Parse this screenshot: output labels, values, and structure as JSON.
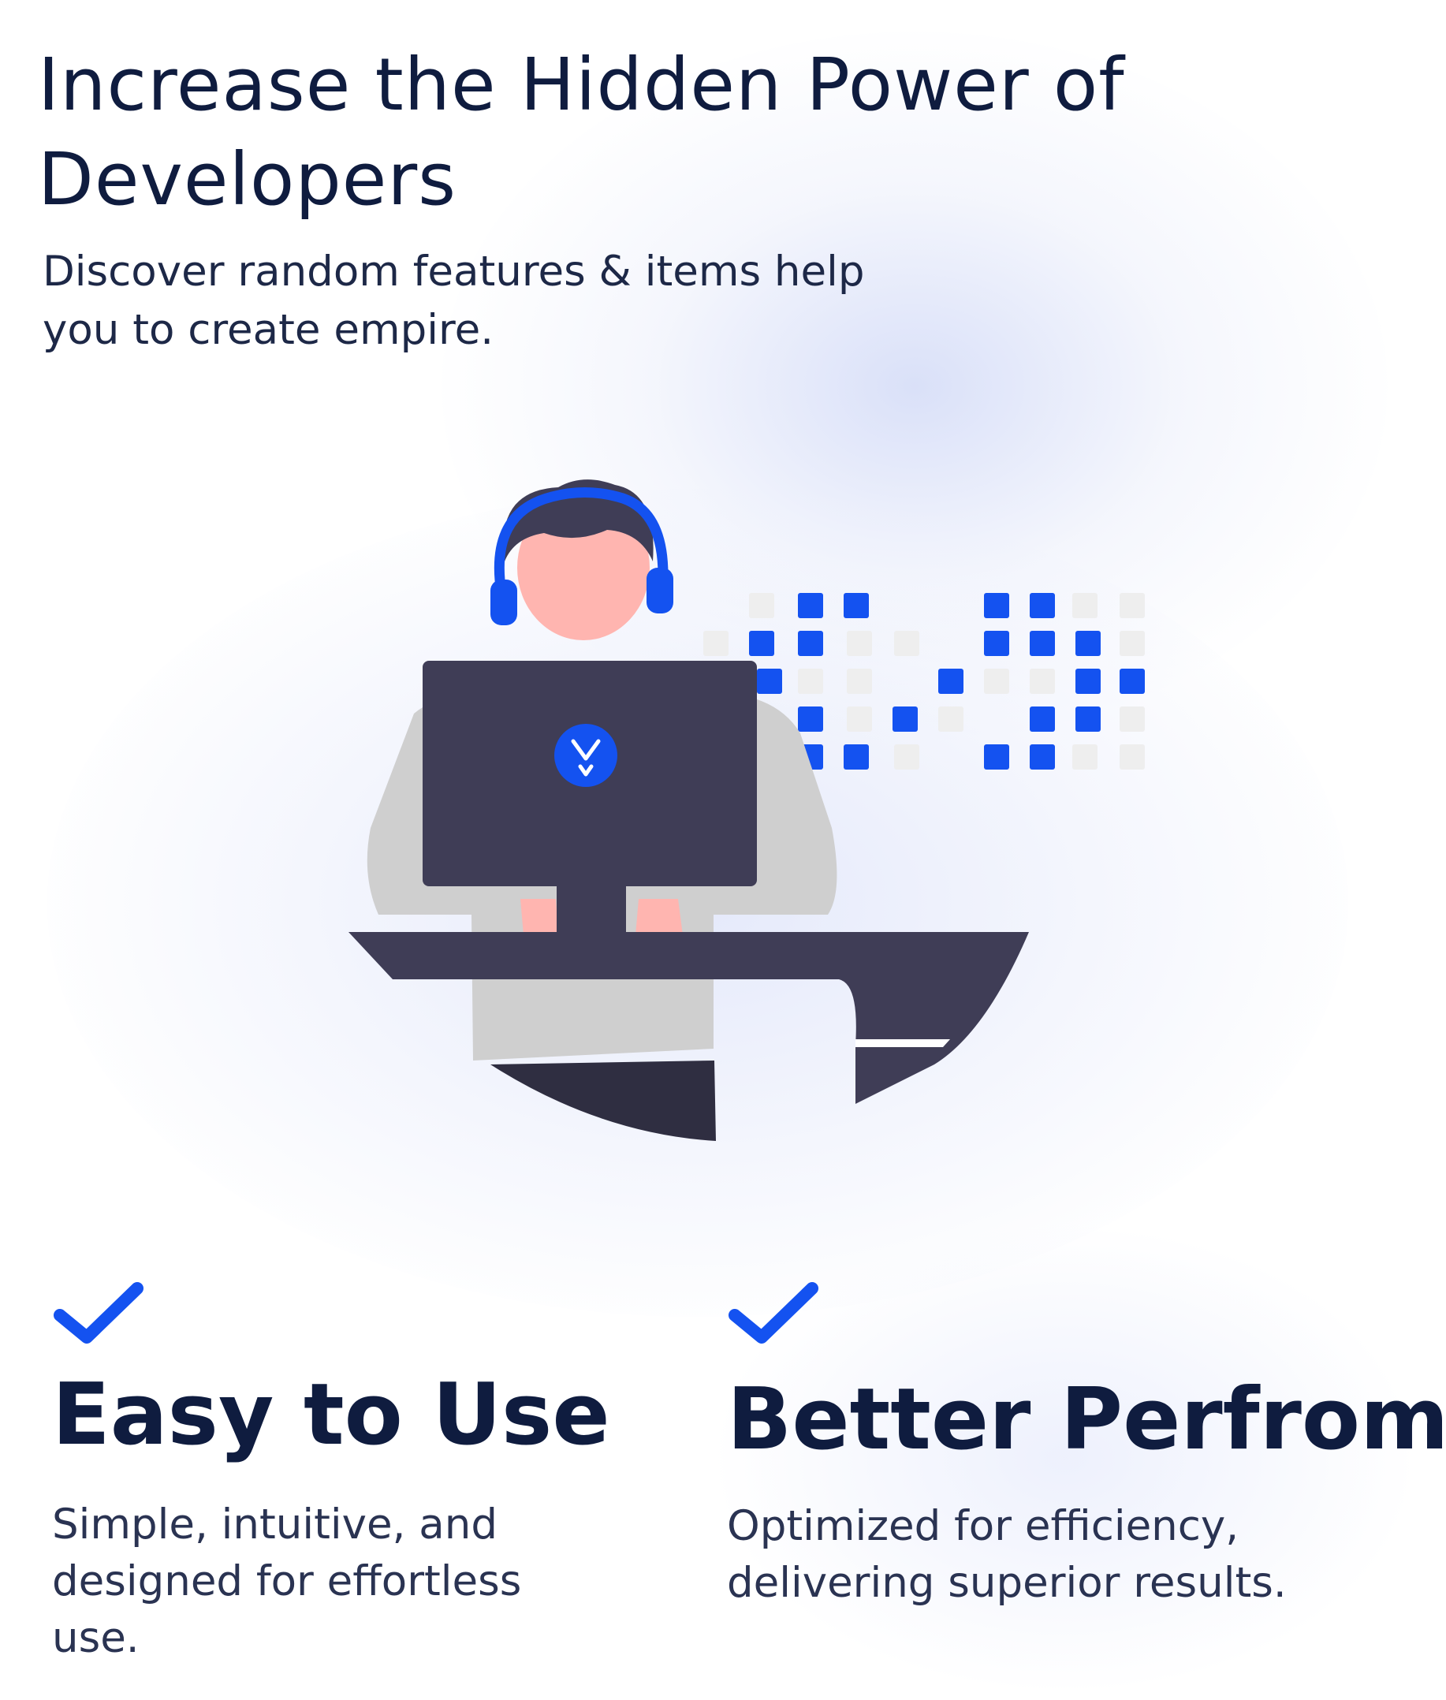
{
  "hero": {
    "title": "Increase the Hidden Power of Developers",
    "subtitle": "Discover random features & items help you to create empire."
  },
  "illustration": {
    "subject": "developer-with-headset-at-computer",
    "logo_icon": "eagle-logo-icon"
  },
  "features": [
    {
      "icon": "checkmark-icon",
      "title": "Easy to Use",
      "description": "Simple, intuitive, and designed for effortless use."
    },
    {
      "icon": "checkmark-icon",
      "title": "Better Perfrom",
      "description": "Optimized for efficiency, delivering superior results."
    }
  ],
  "colors": {
    "accent": "#1452f0",
    "heading": "#0f1c3f",
    "body_text": "#2a3352",
    "dark_object": "#3f3d56",
    "skin": "#ffb5b0",
    "shirt": "#cfcfcf",
    "pixel_inactive": "#f0f0f0"
  }
}
